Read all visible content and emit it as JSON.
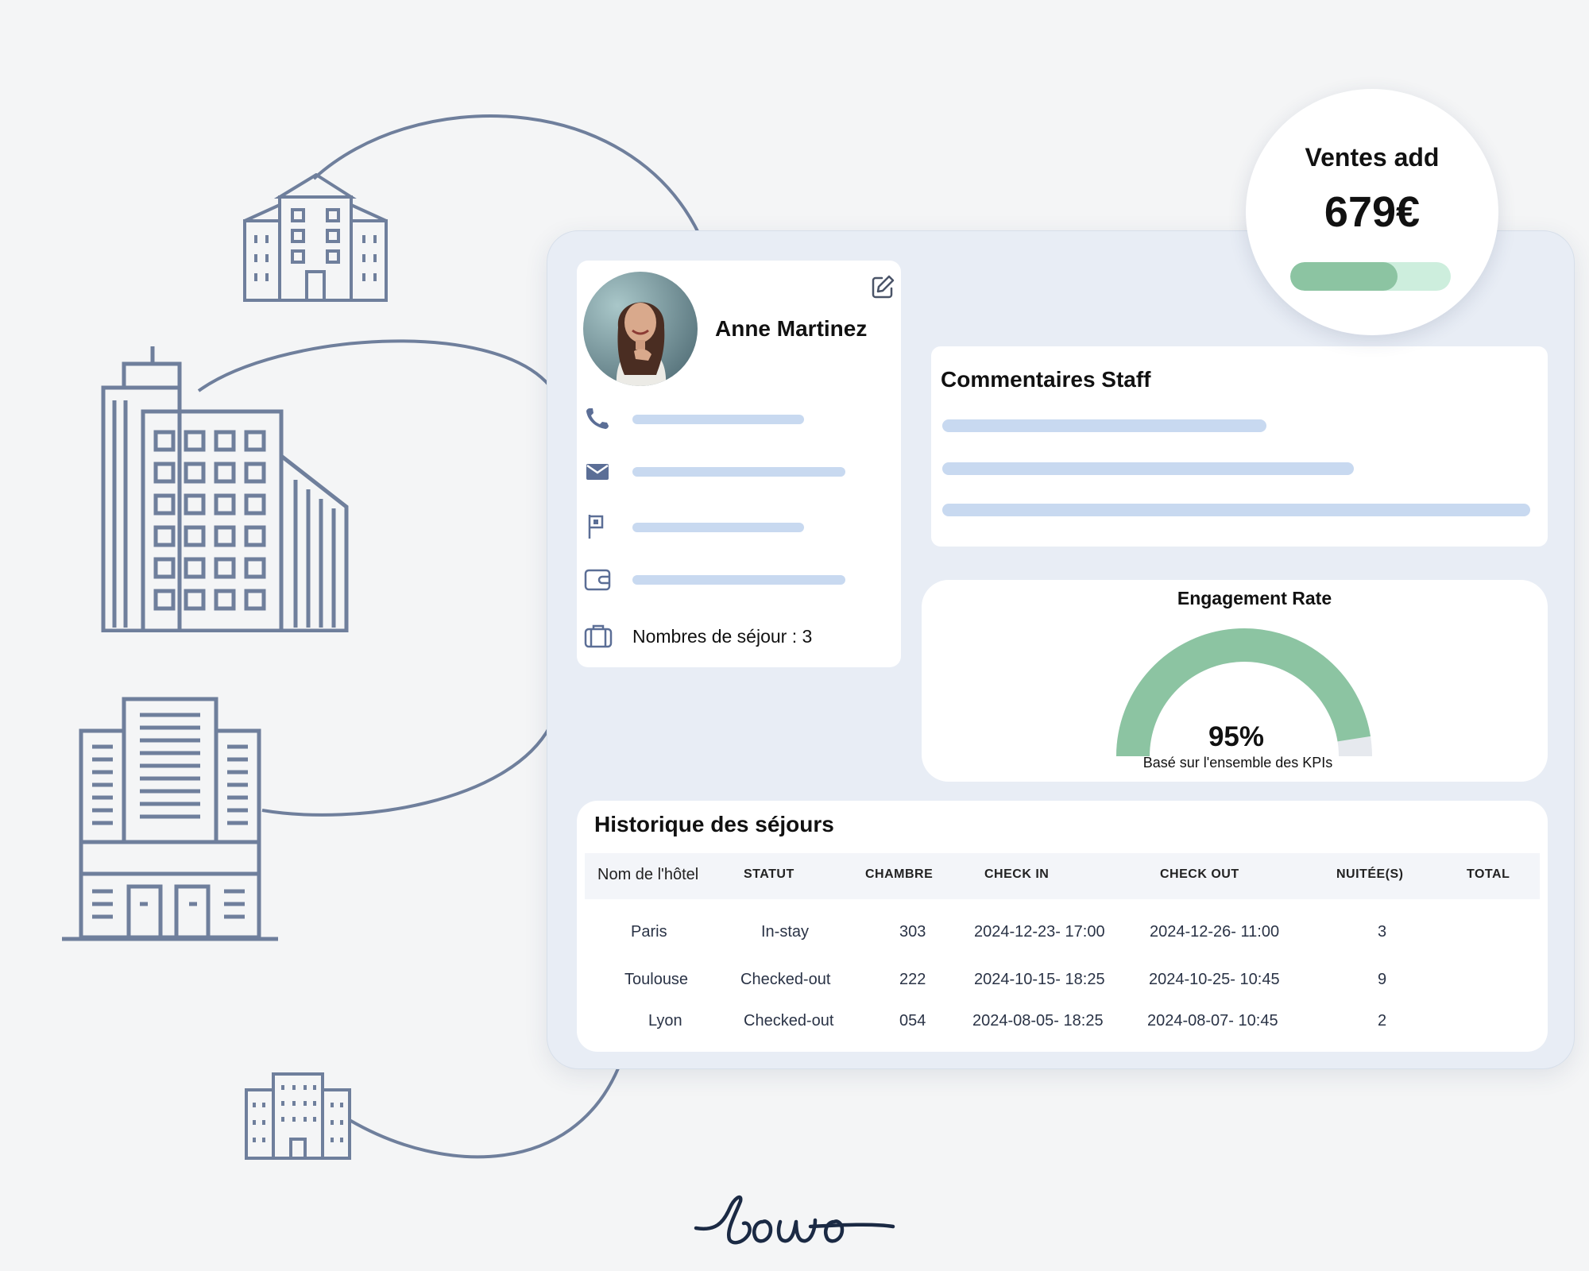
{
  "colors": {
    "accent_green": "#8cc4a2",
    "track_green": "#cdeedd",
    "placeholder_bar": "#c8d9f0",
    "line_art": "#6f7f9c",
    "card_bg": "#e8edf5"
  },
  "ventes": {
    "label": "Ventes add",
    "value": "679€",
    "progress": 0.67
  },
  "profile": {
    "name": "Anne Martinez",
    "rows": [
      {
        "icon": "phone-icon"
      },
      {
        "icon": "mail-icon"
      },
      {
        "icon": "flag-icon"
      },
      {
        "icon": "wallet-icon"
      },
      {
        "icon": "suitcase-icon",
        "text": "Nombres de séjour : 3"
      }
    ]
  },
  "comments": {
    "title": "Commentaires Staff"
  },
  "engagement": {
    "title": "Engagement Rate",
    "value": "95%",
    "fraction": 0.95,
    "subtitle": "Basé sur l'ensemble des KPIs"
  },
  "history": {
    "title": "Historique des séjours",
    "columns": [
      "Nom de l'hôtel",
      "STATUT",
      "CHAMBRE",
      "CHECK IN",
      "CHECK OUT",
      "NUITÉE(S)",
      "TOTAL"
    ],
    "rows": [
      [
        "Paris",
        "In-stay",
        "303",
        "2024-12-23- 17:00",
        "2024-12-26- 11:00",
        "3",
        ""
      ],
      [
        "Toulouse",
        "Checked-out",
        "222",
        "2024-10-15- 18:25",
        "2024-10-25- 10:45",
        "9",
        ""
      ],
      [
        "Lyon",
        "Checked-out",
        "054",
        "2024-08-05- 18:25",
        "2024-08-07- 10:45",
        "2",
        ""
      ]
    ]
  },
  "logo": "bowo"
}
